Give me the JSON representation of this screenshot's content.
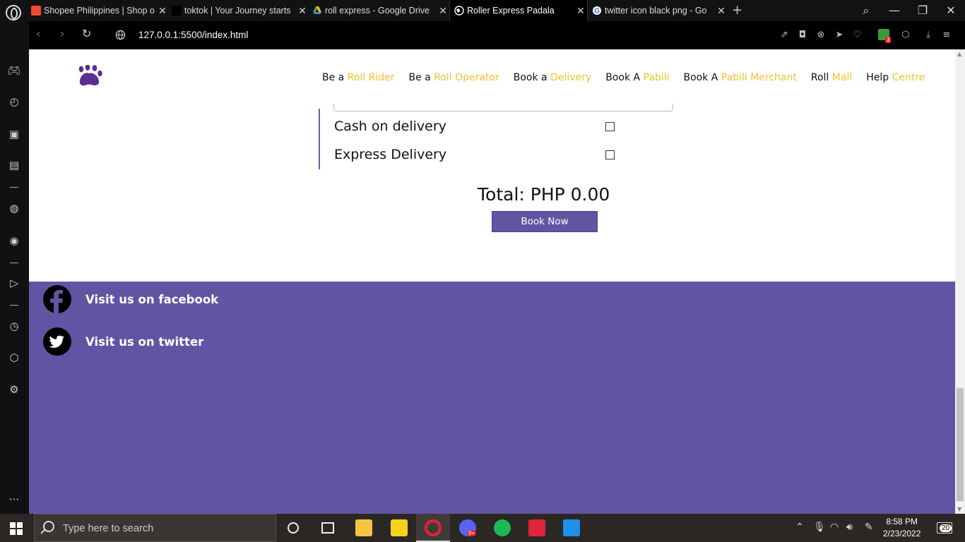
{
  "browser": {
    "tabs": [
      {
        "title": "Shopee Philippines | Shop o",
        "favicon_color": "#ee4d2d",
        "active": false
      },
      {
        "title": "toktok | Your Journey starts",
        "favicon_text": "tok tok",
        "active": false
      },
      {
        "title": "roll express - Google Drive",
        "favicon_color": "#34a853",
        "active": false
      },
      {
        "title": "Roller Express Padala",
        "active": true
      },
      {
        "title": "twitter icon black png - Go",
        "active": false
      }
    ],
    "url": "127.0.0.1:5500/index.html",
    "extension_badge": "3"
  },
  "page": {
    "nav": [
      {
        "pre": "Be a ",
        "hl": "Roll Rider"
      },
      {
        "pre": "Be a ",
        "hl": "Roll Operator"
      },
      {
        "pre": "Book a ",
        "hl": "Delivery"
      },
      {
        "pre": "Book A ",
        "hl": "Pabili"
      },
      {
        "pre": "Book A ",
        "hl": "Pabili Merchant"
      },
      {
        "pre": "Roll ",
        "hl": "Mall"
      },
      {
        "pre": "Help ",
        "hl": "Centre"
      }
    ],
    "options": [
      {
        "label": "Cash on delivery",
        "checked": false
      },
      {
        "label": "Express Delivery",
        "checked": false
      }
    ],
    "total": "Total: PHP 0.00",
    "book_button": "Book Now",
    "footer": {
      "facebook": "Visit us on facebook",
      "twitter": "Visit us on twitter"
    },
    "colors": {
      "primary": "#6055a3",
      "accent": "#f2c12e"
    }
  },
  "taskbar": {
    "search_placeholder": "Type here to search",
    "time": "8:58 PM",
    "date": "2/23/2022",
    "notifications": "20",
    "discord_badge": "9+"
  }
}
